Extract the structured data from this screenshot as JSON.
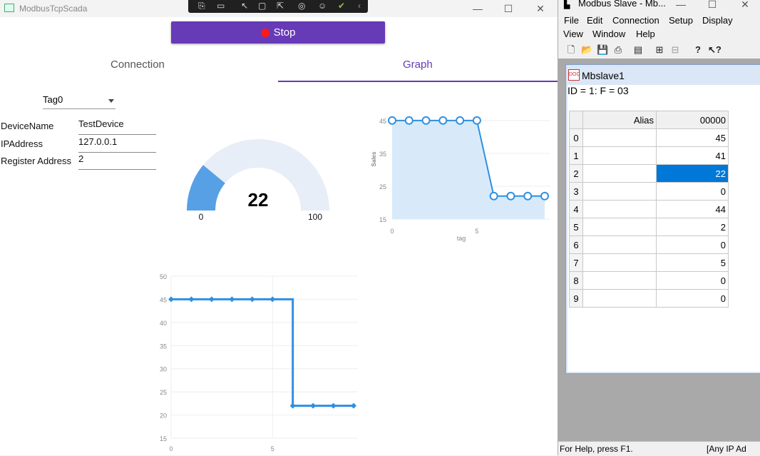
{
  "app": {
    "title": "ModbusTcpScada",
    "stop_label": "Stop",
    "tabs": [
      {
        "label": "Connection"
      },
      {
        "label": "Graph"
      }
    ],
    "tag_select": "Tag0",
    "fields": [
      {
        "label": "DeviceName",
        "value": "TestDevice"
      },
      {
        "label": "IPAddress",
        "value": "127.0.0.1"
      },
      {
        "label": "Register Address",
        "value": "2"
      }
    ],
    "gauge": {
      "value": 22,
      "min": 0,
      "max": 100,
      "value_label": "22",
      "min_label": "0",
      "max_label": "100"
    }
  },
  "colors": {
    "accent": "#673ab7",
    "stop_dot": "#ff1a1a",
    "gauge_fill": "#57a0e5",
    "gauge_track": "#e8eef7",
    "line": "#2f8fe0",
    "selection": "#0078d7"
  },
  "chart_data": [
    {
      "type": "area",
      "x": [
        0,
        1,
        2,
        3,
        4,
        5,
        6,
        7,
        8,
        9
      ],
      "series": [
        {
          "values": [
            45,
            45,
            45,
            45,
            45,
            45,
            22,
            22,
            22,
            22
          ]
        }
      ],
      "xlabel": "tag",
      "ylabel": "Sales",
      "yticks": [
        "15",
        "25",
        "35",
        "45"
      ],
      "xticks": [
        "0",
        "5"
      ],
      "ylim": [
        15,
        48
      ],
      "xlim": [
        0,
        9
      ],
      "grid": true
    },
    {
      "type": "line",
      "step": true,
      "x": [
        0,
        1,
        2,
        3,
        4,
        5,
        6,
        7,
        8,
        9
      ],
      "series": [
        {
          "values": [
            45,
            45,
            45,
            45,
            45,
            45,
            22,
            22,
            22,
            22
          ]
        }
      ],
      "yticks": [
        "15",
        "20",
        "25",
        "30",
        "35",
        "40",
        "45",
        "50"
      ],
      "xticks": [
        "0",
        "5"
      ],
      "ylim": [
        15,
        50
      ],
      "xlim": [
        0,
        9
      ],
      "grid": true
    }
  ],
  "modbus": {
    "title": "Modbus Slave - Mb...",
    "menu": [
      "File",
      "Edit",
      "Connection",
      "Setup",
      "Display",
      "View",
      "Window",
      "Help"
    ],
    "toolbar_icons": [
      "new-icon",
      "open-icon",
      "save-icon",
      "print-icon",
      "window-icon",
      "connect-icon",
      "disconnect-icon",
      "help-icon",
      "context-help-icon"
    ],
    "child_title": "Mbslave1",
    "id_line": "ID = 1: F = 03",
    "grid": {
      "col_alias": "Alias",
      "col_addr": "00000",
      "rows": [
        {
          "idx": "0",
          "value": "45"
        },
        {
          "idx": "1",
          "value": "41"
        },
        {
          "idx": "2",
          "value": "22"
        },
        {
          "idx": "3",
          "value": "0"
        },
        {
          "idx": "4",
          "value": "44"
        },
        {
          "idx": "5",
          "value": "2"
        },
        {
          "idx": "6",
          "value": "0"
        },
        {
          "idx": "7",
          "value": "5"
        },
        {
          "idx": "8",
          "value": "0"
        },
        {
          "idx": "9",
          "value": "0"
        }
      ],
      "selected_row": 2
    },
    "status_left": "For Help, press F1.",
    "status_right": "[Any IP Ad"
  }
}
